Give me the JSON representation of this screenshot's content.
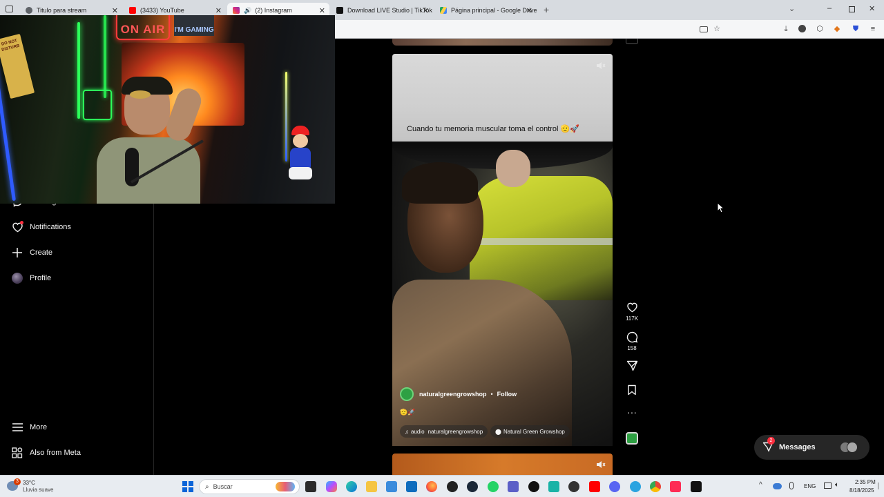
{
  "browser": {
    "tabs": [
      {
        "label": "Titulo para stream",
        "favicon_color": "#5f6368",
        "active": false
      },
      {
        "label": "(3433) YouTube",
        "favicon_color": "#ff0000",
        "active": false
      },
      {
        "label": "(2) Instagram",
        "favicon_color": "#d6249f",
        "active": true
      },
      {
        "label": "Download LIVE Studio | TikTok",
        "favicon_color": "#000000",
        "active": false
      },
      {
        "label": "Página principal - Google Drive",
        "favicon_color": "#1fa463",
        "active": false
      }
    ],
    "new_tab_label": "+"
  },
  "sidebar": {
    "items": [
      {
        "label": "Messages",
        "icon": "messenger-icon"
      },
      {
        "label": "Notifications",
        "icon": "heart-icon"
      },
      {
        "label": "Create",
        "icon": "plus-icon"
      },
      {
        "label": "Profile",
        "icon": "avatar"
      },
      {
        "label": "More",
        "icon": "menu-icon"
      },
      {
        "label": "Also from Meta",
        "icon": "meta-grid-icon"
      }
    ]
  },
  "webcam": {
    "sign_on_air": "ON AIR",
    "sign_gaming": "I'M GAMING",
    "sign_dnd": "DO NOT DISTURB"
  },
  "reel": {
    "caption": "Cuando tu memoria muscular toma el control 🫡🚀",
    "username": "naturalgreengrowshop",
    "separator": "•",
    "follow_label": "Follow",
    "emojis": "🫡🚀",
    "audio_label": "audio",
    "audio_user": "naturalgreengrowshop",
    "location": "Natural Green Growshop",
    "likes": "117K",
    "comments": "158"
  },
  "messages_pill": {
    "label": "Messages",
    "badge": "2"
  },
  "taskbar": {
    "weather_temp": "33°C",
    "weather_desc": "Lluvia suave",
    "weather_badge": "3",
    "search_placeholder": "Buscar",
    "lang": "ENG",
    "time": "2:35 PM",
    "date": "8/18/2025"
  }
}
